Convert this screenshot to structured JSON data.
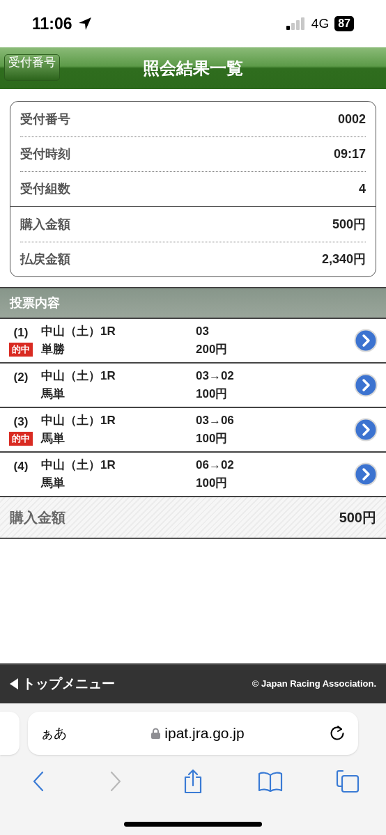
{
  "status_bar": {
    "time": "11:06",
    "network": "4G",
    "battery": "87"
  },
  "header": {
    "back_label": "受付番号",
    "title": "照会結果一覧"
  },
  "summary": {
    "groups": [
      [
        {
          "label": "受付番号",
          "value": "0002"
        },
        {
          "label": "受付時刻",
          "value": "09:17"
        },
        {
          "label": "受付組数",
          "value": "4"
        }
      ],
      [
        {
          "label": "購入金額",
          "value": "500円"
        },
        {
          "label": "払戻金額",
          "value": "2,340円"
        }
      ]
    ]
  },
  "section": {
    "title": "投票内容"
  },
  "bets": [
    {
      "number": "(1)",
      "race": "中山（土）1R",
      "bet_type": "単勝",
      "selection": "03",
      "amount": "200円",
      "badge": "的中"
    },
    {
      "number": "(2)",
      "race": "中山（土）1R",
      "bet_type": "馬単",
      "selection": "03→02",
      "amount": "100円"
    },
    {
      "number": "(3)",
      "race": "中山（土）1R",
      "bet_type": "馬単",
      "selection": "03→06",
      "amount": "100円",
      "badge": "的中"
    },
    {
      "number": "(4)",
      "race": "中山（土）1R",
      "bet_type": "馬単",
      "selection": "06→02",
      "amount": "100円"
    }
  ],
  "total": {
    "label": "購入金額",
    "value": "500円"
  },
  "footer": {
    "menu_link": "トップメニュー",
    "copyright": "© Japan Racing Association."
  },
  "browser": {
    "text_size": "ぁあ",
    "url": "ipat.jra.go.jp",
    "toolbar": [
      {
        "kind": "back",
        "disabled": false
      },
      {
        "kind": "forward",
        "disabled": true
      },
      {
        "kind": "share",
        "disabled": false
      },
      {
        "kind": "bookmarks",
        "disabled": false
      },
      {
        "kind": "tabs",
        "disabled": false
      }
    ]
  }
}
